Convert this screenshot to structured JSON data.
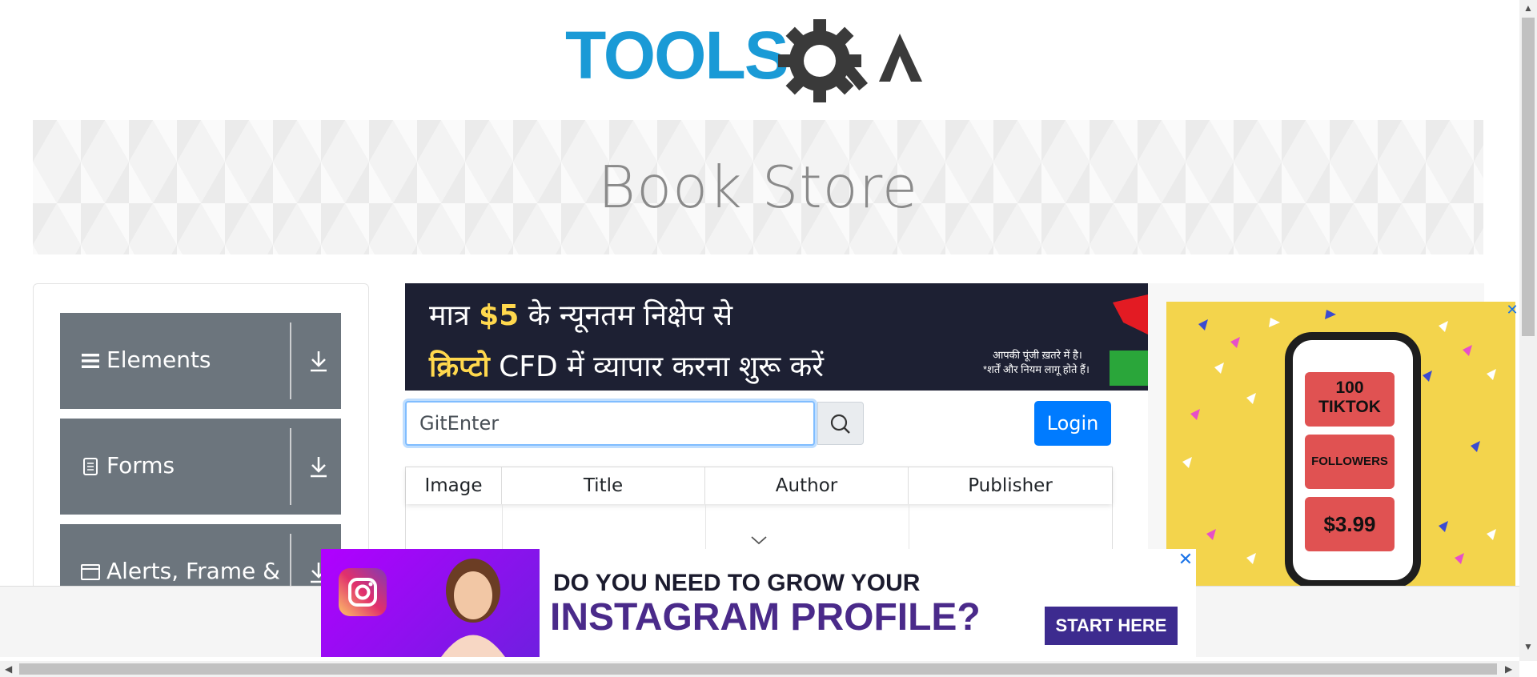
{
  "header": {
    "logo_text_tools": "TOOLS",
    "logo_text_qa": "QA"
  },
  "banner": {
    "title": "Book Store"
  },
  "sidebar": {
    "groups": [
      {
        "label": "Elements",
        "icon": "menu-icon"
      },
      {
        "label": "Forms",
        "icon": "document-icon"
      },
      {
        "label": "Alerts, Frame &",
        "icon": "window-icon"
      }
    ]
  },
  "ad_top": {
    "line1_prefix": "मात्र ",
    "line1_amount": "$5",
    "line1_suffix": " के न्यूनतम निक्षेप से",
    "line2_highlight": "क्रिप्टो",
    "line2_rest": " CFD में  व्यापार करना शुरू करें",
    "note1": "आपकी पूंजी ख़तरे में है।",
    "note2": "*शर्तें और नियम लागू होते हैं।"
  },
  "search": {
    "value": "GitEnter",
    "icon": "search-icon"
  },
  "login": {
    "label": "Login"
  },
  "table": {
    "headers": [
      "Image",
      "Title",
      "Author",
      "Publisher"
    ]
  },
  "ad_right": {
    "box1_line1": "100",
    "box1_line2": "TIKTOK",
    "box2": "FOLLOWERS",
    "box3": "$3.99",
    "close": "✕"
  },
  "ad_bottom": {
    "line1": "DO YOU NEED TO GROW YOUR",
    "line2": "INSTAGRAM PROFILE?",
    "cta": "START HERE",
    "close": "✕"
  },
  "colors": {
    "accent": "#007bff",
    "sidebar_bg": "#6c757d",
    "logo_blue": "#1a9ad6",
    "logo_dark": "#333333"
  }
}
